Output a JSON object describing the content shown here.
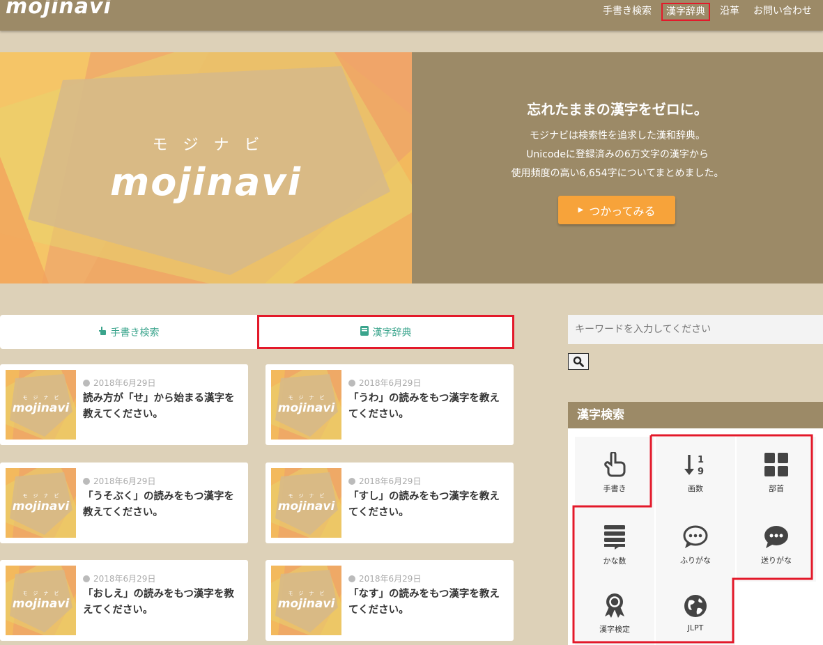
{
  "header": {
    "logo": "mojinavi",
    "nav": [
      "手書き検索",
      "漢字辞典",
      "沿革",
      "お問い合わせ"
    ]
  },
  "hero": {
    "kana": "モジナビ",
    "logo": "mojinavi",
    "title": "忘れたままの漢字をゼロに。",
    "desc": [
      "モジナビは検索性を追求した漢和辞典。",
      "Unicodeに登録済みの6万文字の漢字から",
      "使用頻度の高い6,654字についてまとめました。"
    ],
    "button": "つかってみる"
  },
  "tabs": [
    "手書き検索",
    "漢字辞典"
  ],
  "cards": [
    {
      "date": "2018年6月29日",
      "title": "読み方が「せ」から始まる漢字を教えてください。"
    },
    {
      "date": "2018年6月29日",
      "title": "「うわ」の読みをもつ漢字を教えてください。"
    },
    {
      "date": "2018年6月29日",
      "title": "「うそぶく」の読みをもつ漢字を教えてください。"
    },
    {
      "date": "2018年6月29日",
      "title": "「すし」の読みをもつ漢字を教えてください。"
    },
    {
      "date": "2018年6月29日",
      "title": "「おしえ」の読みをもつ漢字を教えてください。"
    },
    {
      "date": "2018年6月29日",
      "title": "「なす」の読みをもつ漢字を教えてください。"
    }
  ],
  "thumb": {
    "kana": "モジナビ",
    "logo": "mojinavi"
  },
  "search": {
    "placeholder": "キーワードを入力してください"
  },
  "widget": {
    "title": "漢字検索",
    "buttons": [
      "手書き",
      "画数",
      "部首",
      "かな数",
      "ふりがな",
      "送りがな",
      "漢字検定",
      "JLPT"
    ]
  },
  "colors": {
    "brand": "#9c8a67",
    "accent": "#f7a33a",
    "teal": "#3aa48c",
    "highlight": "#e3192a"
  }
}
